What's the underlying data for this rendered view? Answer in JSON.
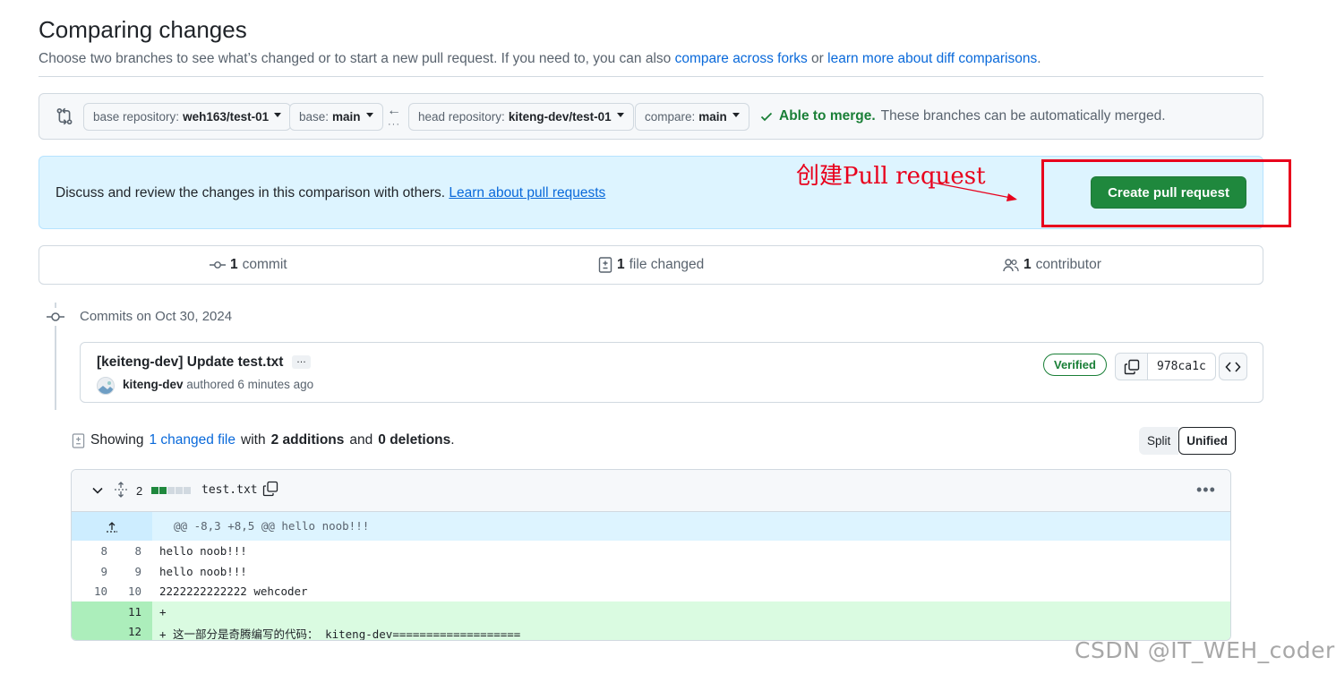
{
  "page": {
    "title": "Comparing changes",
    "subtitle_prefix": "Choose two branches to see what’s changed or to start a new pull request. If you need to, you can also ",
    "subtitle_link1": "compare across forks",
    "subtitle_mid": " or ",
    "subtitle_link2": "learn more about diff comparisons",
    "subtitle_suffix": "."
  },
  "range": {
    "base_repo_label": "base repository:",
    "base_repo": "weh163/test-01",
    "base_label": "base:",
    "base": "main",
    "head_repo_label": "head repository:",
    "head_repo": "kiteng-dev/test-01",
    "compare_label": "compare:",
    "compare": "main",
    "merge_ok": "Able to merge.",
    "merge_note": "These branches can be automatically merged."
  },
  "flash": {
    "text": "Discuss and review the changes in this comparison with others. ",
    "link": "Learn about pull requests",
    "create_button": "Create pull request"
  },
  "annotation": {
    "text": "创建Pull request",
    "color": "#e8001c"
  },
  "summary": {
    "commits_count": "1",
    "commits_label": "commit",
    "files_count": "1",
    "files_label": "file changed",
    "contributors_count": "1",
    "contributors_label": "contributor"
  },
  "commits": {
    "date_heading": "Commits on Oct 30, 2024",
    "title": "[keiteng-dev] Update test.txt",
    "ellipsis": "…",
    "author": "kiteng-dev",
    "authored": "authored 6 minutes ago",
    "verified": "Verified",
    "sha": "978ca1c"
  },
  "diff_summary": {
    "showing": "Showing",
    "changed_link": "1 changed file",
    "with": "with",
    "additions": "2 additions",
    "and": "and",
    "deletions": "0 deletions",
    "end": ".",
    "split_label": "Split",
    "unified_label": "Unified"
  },
  "file": {
    "change_count": "2",
    "name": "test.txt",
    "diffstat": [
      "add",
      "add",
      "neutral",
      "neutral",
      "neutral"
    ],
    "hunk_header": "@@ -8,3 +8,5 @@ hello noob!!!",
    "lines": [
      {
        "old": "8",
        "new": "8",
        "type": "context",
        "text": "hello noob!!!"
      },
      {
        "old": "9",
        "new": "9",
        "type": "context",
        "text": "hello noob!!!"
      },
      {
        "old": "10",
        "new": "10",
        "type": "context",
        "text": "2222222222222 wehcoder"
      },
      {
        "old": "",
        "new": "11",
        "type": "add",
        "text": "+"
      },
      {
        "old": "",
        "new": "12",
        "type": "add",
        "text": "+ 这一部分是奇腾编写的代码： kiteng-dev==================="
      }
    ]
  },
  "colors": {
    "primary_button": "#1f883d",
    "link": "#0969da",
    "success": "#1a7f37",
    "flash_bg": "#ddf4ff",
    "add_bg": "#dafbe1"
  },
  "watermark": "CSDN @IT_WEH_coder"
}
